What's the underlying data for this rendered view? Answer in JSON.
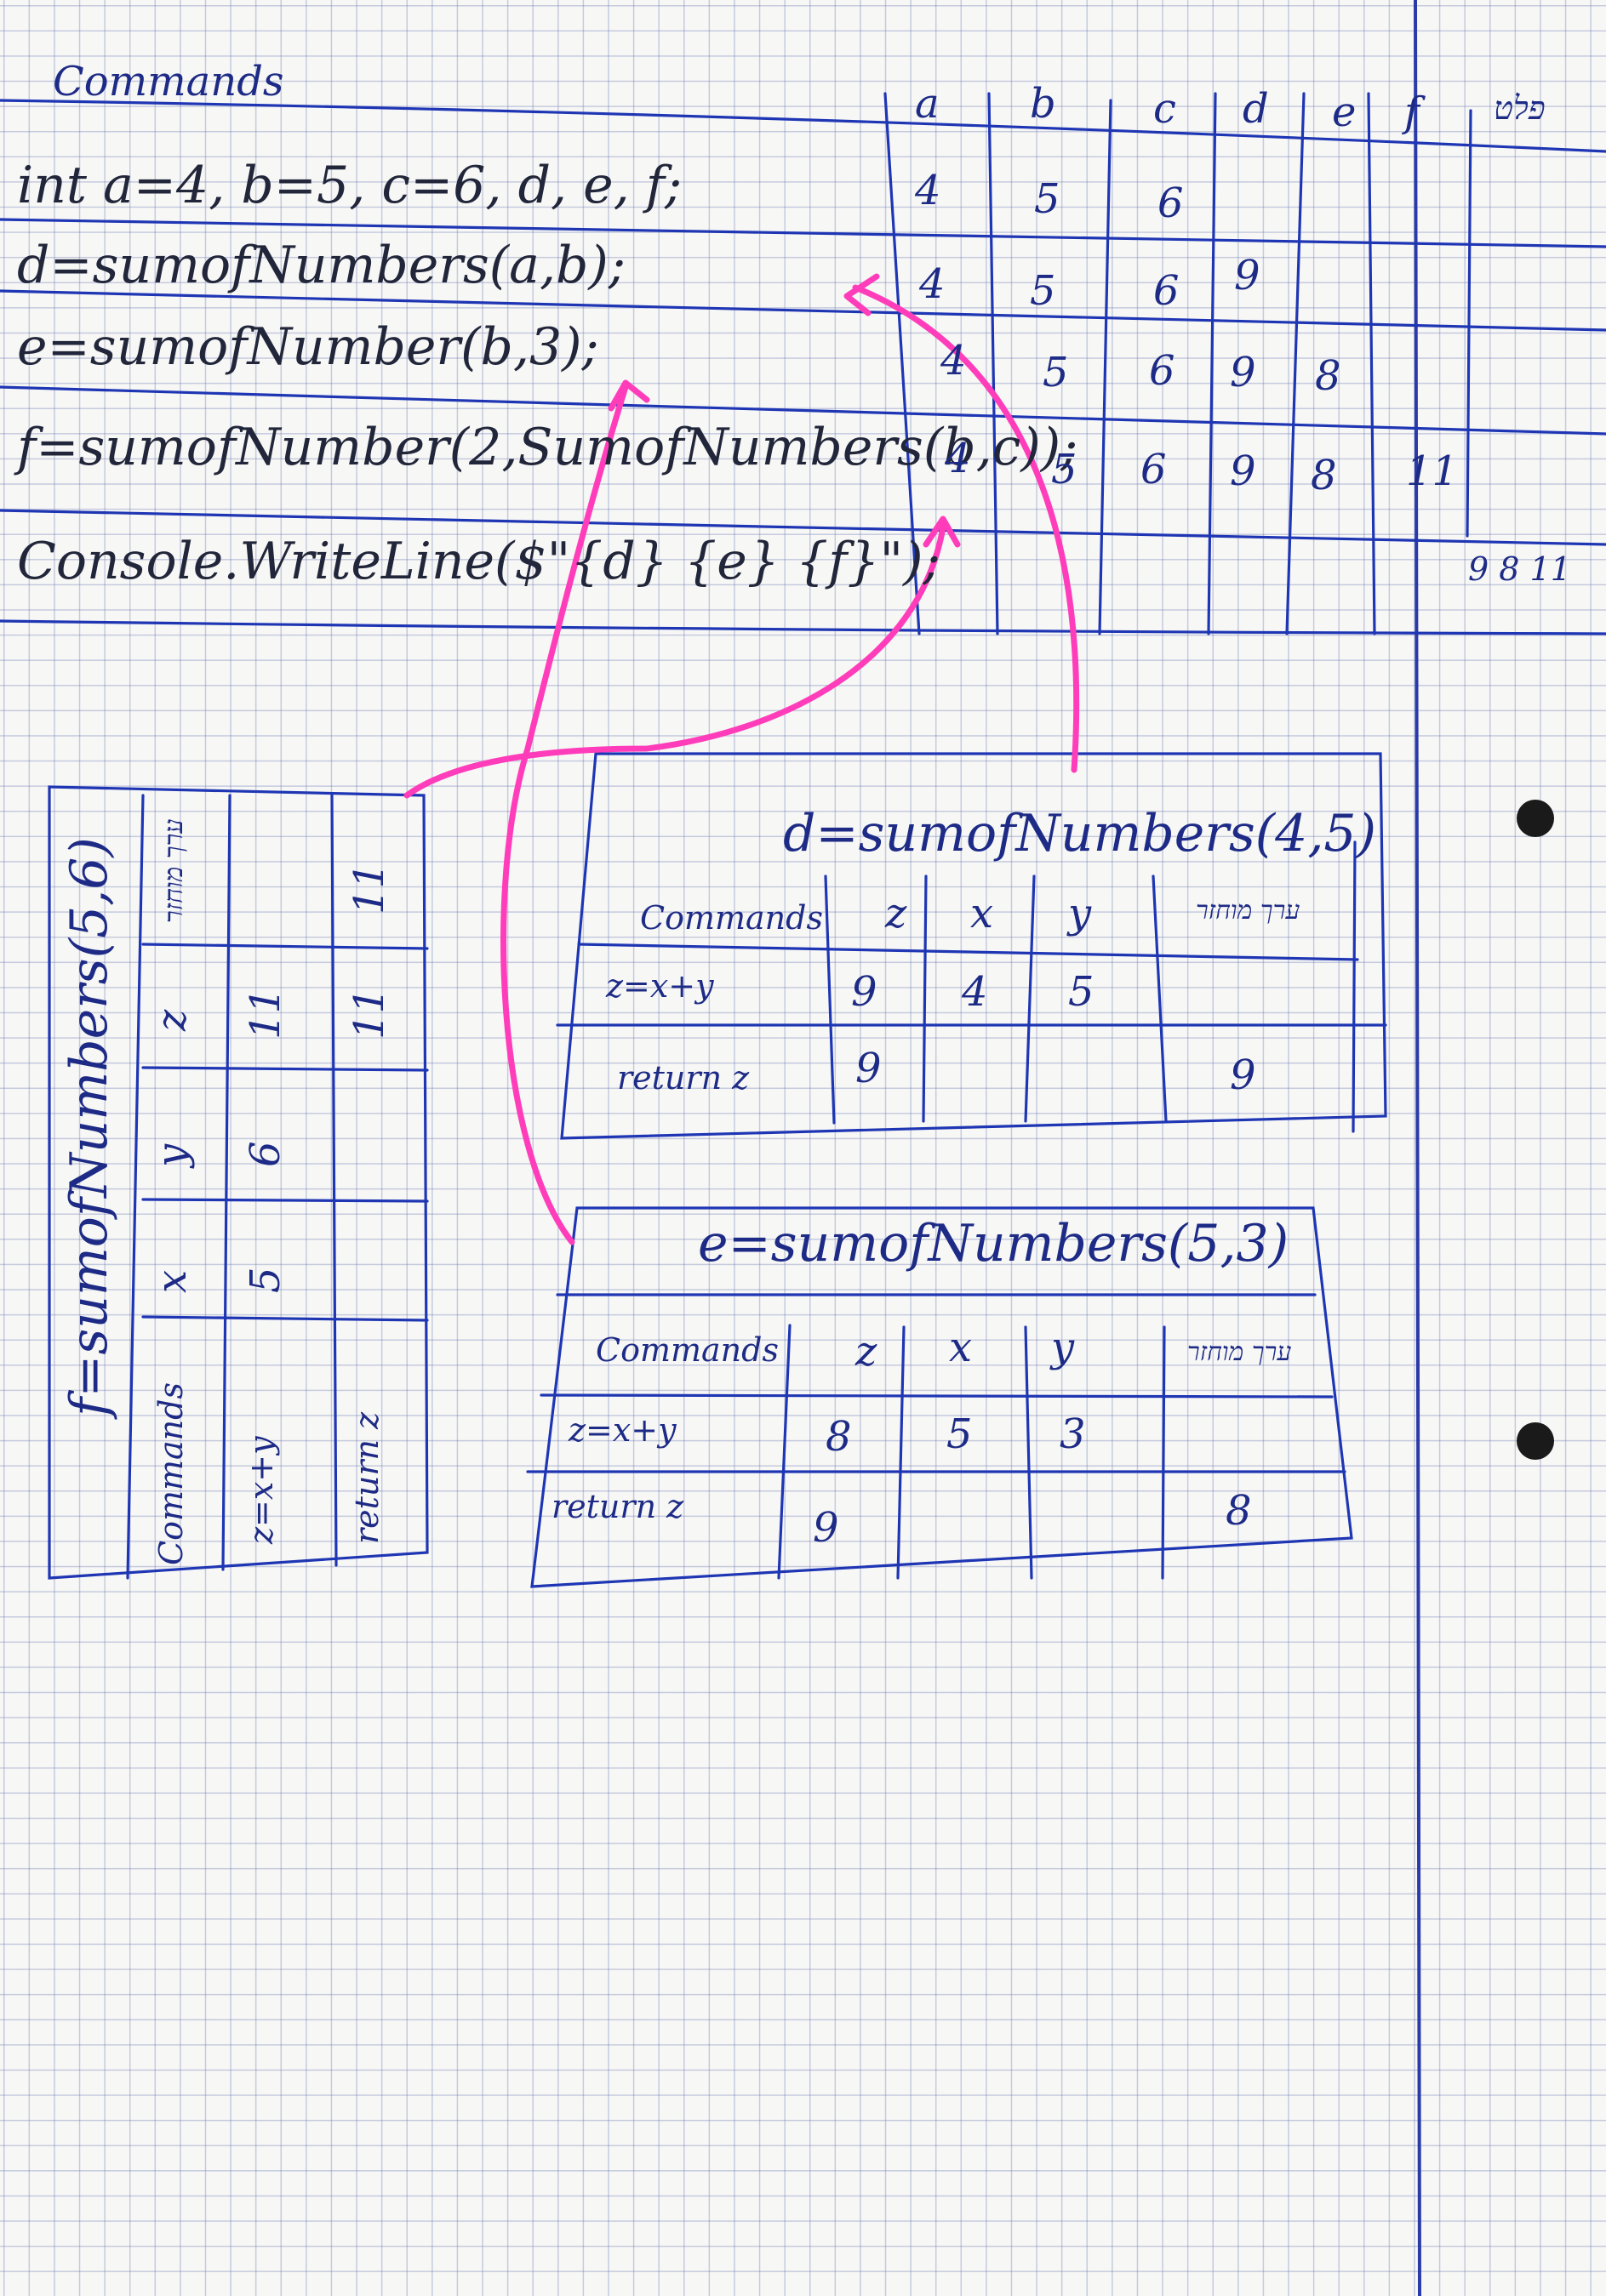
{
  "main": {
    "header": "Commands",
    "code": [
      "int a=4, b=5, c=6, d, e, f;",
      "d=sumofNumbers(a,b);",
      "e=sumofNumber(b,3);",
      "f=sumofNumber(2,SumofNumbers(b,c));",
      "Console.WriteLine($\"{d} {e} {f}\");"
    ],
    "columns": [
      "a",
      "b",
      "c",
      "d",
      "e",
      "f",
      "פלט"
    ],
    "rows": [
      [
        "4",
        "5",
        "6",
        "",
        "",
        "",
        ""
      ],
      [
        "4",
        "5",
        "6",
        "9",
        "",
        "",
        ""
      ],
      [
        "4",
        "5",
        "6",
        "9",
        "8",
        "",
        ""
      ],
      [
        "4",
        "5",
        "6",
        "9",
        "8",
        "11",
        ""
      ],
      [
        "",
        "",
        "",
        "",
        "",
        "",
        "9 8 11"
      ]
    ]
  },
  "trace_d": {
    "title": "d=sumofNumbers(4,5)",
    "headers": [
      "Commands",
      "z",
      "x",
      "y",
      "ערך מוחזר"
    ],
    "rows": [
      [
        "z=x+y",
        "9",
        "4",
        "5",
        ""
      ],
      [
        "return z",
        "9",
        "",
        "",
        "9"
      ]
    ]
  },
  "trace_e": {
    "title": "e=sumofNumbers(5,3)",
    "headers": [
      "Commands",
      "z",
      "x",
      "y",
      "ערך מוחזר"
    ],
    "rows": [
      [
        "z=x+y",
        "8",
        "5",
        "3",
        ""
      ],
      [
        "return z",
        "9",
        "",
        "",
        "8"
      ]
    ]
  },
  "trace_f": {
    "title": "f=sumofNumbers(5,6)",
    "headers": [
      "Commands",
      "x",
      "y",
      "z",
      "ערך מוחזר"
    ],
    "rows": [
      [
        "z=x+y",
        "5",
        "6",
        "11",
        "11"
      ],
      [
        "return z",
        "",
        "",
        "",
        "11"
      ]
    ]
  }
}
